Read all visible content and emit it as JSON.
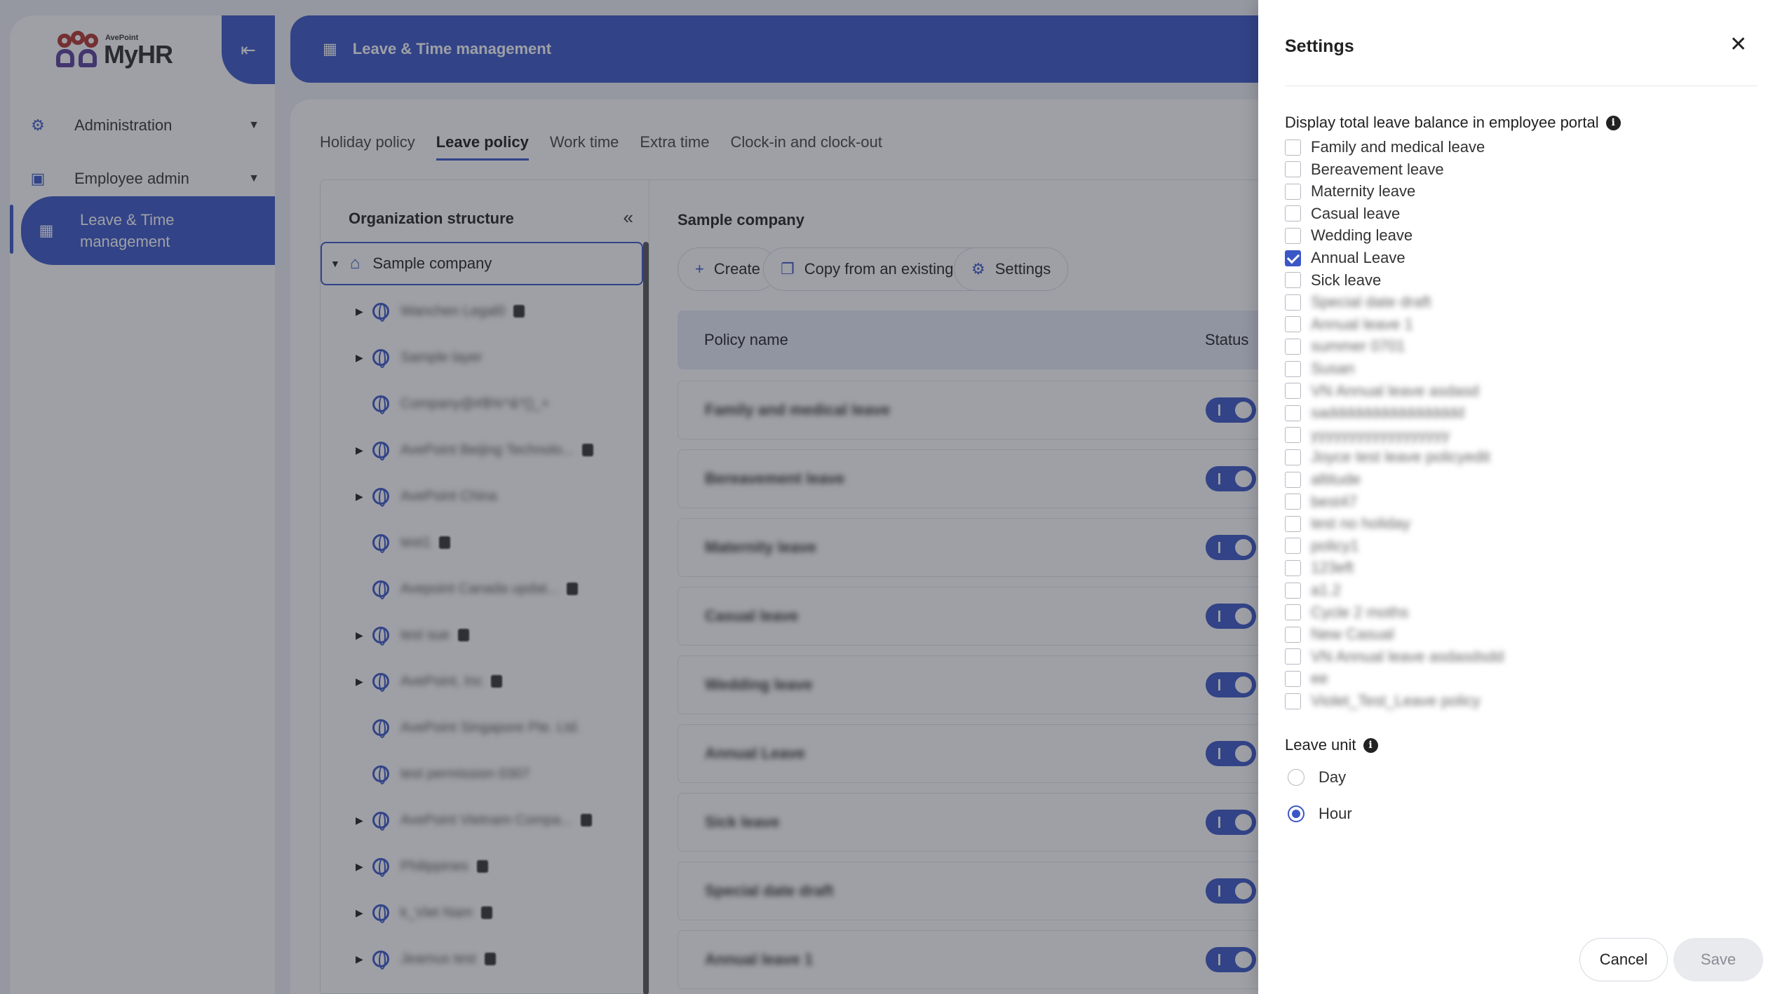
{
  "sidebar": {
    "logo_brand": "AvePoint",
    "logo_name": "MyHR",
    "items": [
      {
        "label": "Administration"
      },
      {
        "label": "Employee admin"
      },
      {
        "label": "Leave & Time management"
      }
    ]
  },
  "header": {
    "title": "Leave & Time management"
  },
  "tabs": [
    "Holiday policy",
    "Leave policy",
    "Work time",
    "Extra time",
    "Clock-in and clock-out"
  ],
  "org": {
    "title": "Organization structure",
    "root": "Sample company",
    "children": [
      "Wanchen Legal0",
      "Sample layer",
      "Company@#$%^&*()_+",
      "AvePoint Beijing Technolo...",
      "AvePoint China",
      "test1",
      "Avepoint Canada updat...",
      "test sue",
      "AvePoint, Inc",
      "AvePoint Singapore Pte. Ltd.",
      "test permission 0307",
      "AvePoint Vietnam Compa...",
      "Philippines",
      "k_Viet Nam",
      "Jeamus test"
    ]
  },
  "policy": {
    "title": "Sample company",
    "buttons": {
      "create": "Create",
      "copy": "Copy from an existing policy",
      "settings": "Settings"
    },
    "columns": {
      "name": "Policy name",
      "status": "Status"
    },
    "rows": [
      "Family and medical leave",
      "Bereavement leave",
      "Maternity leave",
      "Casual leave",
      "Wedding leave",
      "Annual Leave",
      "Sick leave",
      "Special date draft",
      "Annual leave 1"
    ]
  },
  "settings": {
    "title": "Settings",
    "display_label": "Display total leave balance in employee portal",
    "options": [
      {
        "label": "Family and medical leave",
        "checked": false,
        "blurred": false
      },
      {
        "label": "Bereavement leave",
        "checked": false,
        "blurred": false
      },
      {
        "label": "Maternity leave",
        "checked": false,
        "blurred": false
      },
      {
        "label": "Casual leave",
        "checked": false,
        "blurred": false
      },
      {
        "label": "Wedding leave",
        "checked": false,
        "blurred": false
      },
      {
        "label": "Annual Leave",
        "checked": true,
        "blurred": false
      },
      {
        "label": "Sick leave",
        "checked": false,
        "blurred": false
      },
      {
        "label": "Special date draft",
        "checked": false,
        "blurred": true
      },
      {
        "label": "Annual leave 1",
        "checked": false,
        "blurred": true
      },
      {
        "label": "summer 0701",
        "checked": false,
        "blurred": true
      },
      {
        "label": "Susan",
        "checked": false,
        "blurred": true
      },
      {
        "label": "VN Annual leave asdasd",
        "checked": false,
        "blurred": true
      },
      {
        "label": "sadddddddddddddddd",
        "checked": false,
        "blurred": true
      },
      {
        "label": "yyyyyyyyyyyyyyyyyy",
        "checked": false,
        "blurred": true
      },
      {
        "label": "Joyce test leave policyedit",
        "checked": false,
        "blurred": true
      },
      {
        "label": "altitude",
        "checked": false,
        "blurred": true
      },
      {
        "label": "best47",
        "checked": false,
        "blurred": true
      },
      {
        "label": "test no holiday",
        "checked": false,
        "blurred": true
      },
      {
        "label": "policy1",
        "checked": false,
        "blurred": true
      },
      {
        "label": "123eft",
        "checked": false,
        "blurred": true
      },
      {
        "label": "a1.2",
        "checked": false,
        "blurred": true
      },
      {
        "label": "Cycle 2 moths",
        "checked": false,
        "blurred": true
      },
      {
        "label": "New Casual",
        "checked": false,
        "blurred": true
      },
      {
        "label": "VN Annual leave asdasdsdd",
        "checked": false,
        "blurred": true
      },
      {
        "label": "ee",
        "checked": false,
        "blurred": true
      },
      {
        "label": "Violet_Test_Leave policy",
        "checked": false,
        "blurred": true
      }
    ],
    "unit_label": "Leave unit",
    "units": [
      {
        "label": "Day",
        "selected": false
      },
      {
        "label": "Hour",
        "selected": true
      }
    ],
    "cancel": "Cancel",
    "save": "Save"
  }
}
